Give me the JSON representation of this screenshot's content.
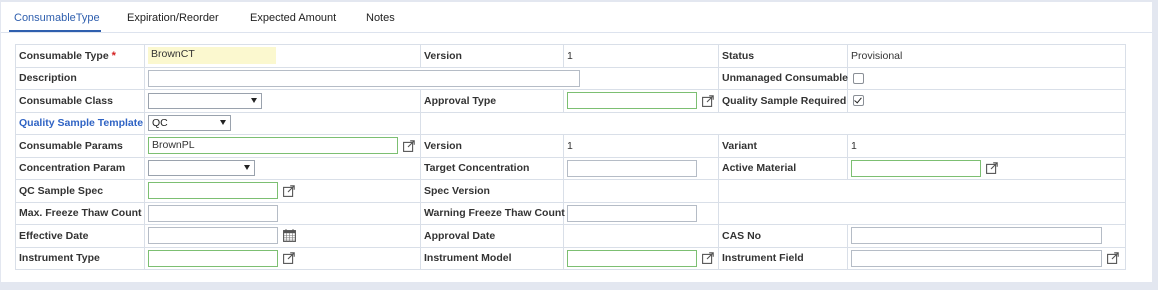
{
  "tabs": [
    "ConsumableType",
    "Expiration/Reorder",
    "Expected Amount",
    "Notes"
  ],
  "required_marker": "*",
  "fields": {
    "consumable_type": {
      "label": "Consumable Type",
      "value": "BrownCT"
    },
    "version": {
      "label": "Version",
      "value": "1"
    },
    "status": {
      "label": "Status",
      "value": "Provisional"
    },
    "description": {
      "label": "Description",
      "value": ""
    },
    "unmanaged_consumable": {
      "label": "Unmanaged Consumable",
      "checked": false
    },
    "consumable_class": {
      "label": "Consumable Class",
      "value": ""
    },
    "approval_type": {
      "label": "Approval Type",
      "value": ""
    },
    "quality_sample_required": {
      "label": "Quality Sample Required",
      "checked": true
    },
    "quality_sample_template": {
      "label": "Quality Sample Template",
      "value": "QC"
    },
    "consumable_params": {
      "label": "Consumable Params",
      "value": "BrownPL"
    },
    "params_version": {
      "label": "Version",
      "value": "1"
    },
    "variant": {
      "label": "Variant",
      "value": "1"
    },
    "concentration_param": {
      "label": "Concentration Param",
      "value": ""
    },
    "target_concentration": {
      "label": "Target Concentration",
      "value": ""
    },
    "active_material": {
      "label": "Active Material",
      "value": ""
    },
    "qc_sample_spec": {
      "label": "QC Sample Spec",
      "value": ""
    },
    "spec_version": {
      "label": "Spec Version",
      "value": ""
    },
    "max_freeze_thaw_count": {
      "label": "Max. Freeze Thaw Count",
      "value": ""
    },
    "warning_freeze_thaw_count": {
      "label": "Warning Freeze Thaw Count",
      "value": ""
    },
    "effective_date": {
      "label": "Effective Date",
      "value": ""
    },
    "approval_date": {
      "label": "Approval Date",
      "value": ""
    },
    "cas_no": {
      "label": "CAS No",
      "value": ""
    },
    "instrument_type": {
      "label": "Instrument Type",
      "value": ""
    },
    "instrument_model": {
      "label": "Instrument Model",
      "value": ""
    },
    "instrument_field": {
      "label": "Instrument Field",
      "value": ""
    }
  },
  "colors": {
    "accent": "#2f5fae",
    "required": "#d32020",
    "valid_border": "#7cbf72",
    "highlight": "#fbf8cf"
  }
}
